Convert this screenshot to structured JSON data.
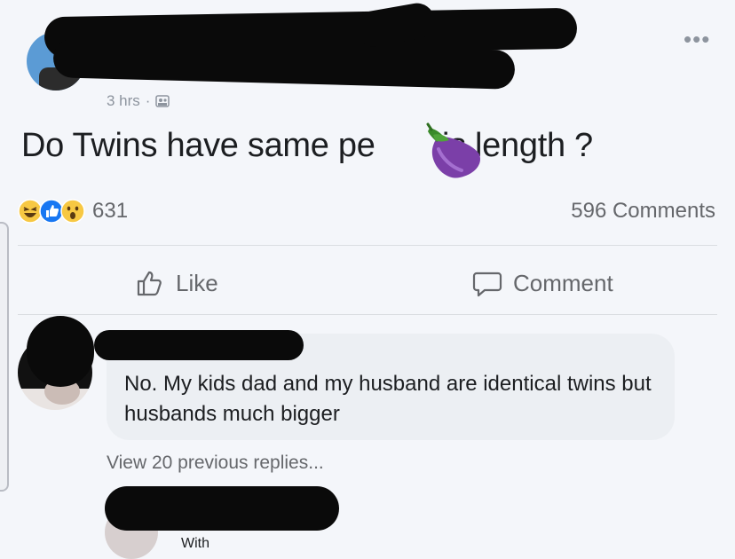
{
  "post": {
    "timestamp": "3 hrs",
    "separator": "·",
    "text": "Do Twins have same pe  is length ?",
    "reaction_count": "631",
    "comment_count": "596 Comments"
  },
  "actions": {
    "like_label": "Like",
    "comment_label": "Comment"
  },
  "comment": {
    "text": "No. My kids dad and my husband are identical twins but husbands much bigger",
    "view_replies": "View 20 previous replies..."
  },
  "reply": {
    "snippet": "With"
  },
  "icons": {
    "more": "more-options-icon",
    "privacy": "friends-privacy-icon",
    "emoji": "eggplant-emoji",
    "reactions": [
      "haha-reaction-icon",
      "like-reaction-icon",
      "wow-reaction-icon"
    ],
    "like": "thumbs-up-icon",
    "comment": "speech-bubble-icon"
  },
  "colors": {
    "like_blue": "#1877f2",
    "reaction_yellow": "#f7c843",
    "muted_text": "#65676b"
  }
}
